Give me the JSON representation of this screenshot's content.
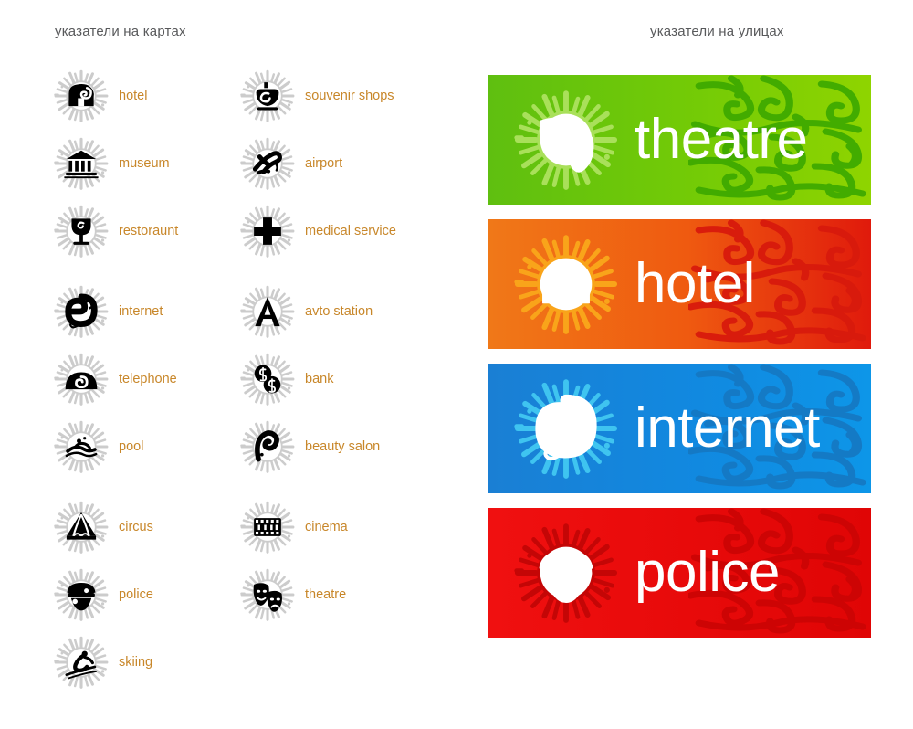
{
  "headers": {
    "left": "указатели на картах",
    "right": "указатели на улицах"
  },
  "colors": {
    "badge_gray": "#cccccc",
    "glyph_orange": "#f07818",
    "glyph_red": "#d8291c",
    "label_text": "#c8872a",
    "header_text": "#58595b",
    "theatre_left": "#5bbf10",
    "theatre_right": "#8fd400",
    "theatre_ornament": "#3faa00",
    "hotel_left": "#f07818",
    "hotel_right": "#e01a0c",
    "hotel_ornament": "#d81a0c",
    "internet_left": "#1a7fd4",
    "internet_right": "#0d96e8",
    "internet_ornament": "#1579c4",
    "police_left": "#ef0f0f",
    "police_right": "#e00505",
    "police_ornament": "#cc0404"
  },
  "map_markers": {
    "column_1": [
      {
        "label": "hotel",
        "icon": "hotel-icon"
      },
      {
        "label": "museum",
        "icon": "museum-icon"
      },
      {
        "label": "restoraunt",
        "icon": "restaurant-icon"
      },
      {
        "label": "internet",
        "icon": "internet-e-icon"
      },
      {
        "label": "telephone",
        "icon": "telephone-icon"
      },
      {
        "label": "pool",
        "icon": "pool-icon"
      },
      {
        "label": "circus",
        "icon": "circus-tent-icon"
      },
      {
        "label": "police",
        "icon": "police-cap-icon"
      },
      {
        "label": "skiing",
        "icon": "skier-icon"
      }
    ],
    "column_2": [
      {
        "label": "souvenir shops",
        "icon": "souvenir-vase-icon"
      },
      {
        "label": "airport",
        "icon": "airplane-icon"
      },
      {
        "label": "medical service",
        "icon": "medical-cross-icon"
      },
      {
        "label": "avto station",
        "icon": "letter-a-icon"
      },
      {
        "label": "bank",
        "icon": "dollar-coins-icon"
      },
      {
        "label": "beauty salon",
        "icon": "beauty-curl-icon"
      },
      {
        "label": "cinema",
        "icon": "film-strip-icon"
      },
      {
        "label": "theatre",
        "icon": "theatre-masks-icon"
      }
    ]
  },
  "street_signs": [
    {
      "label": "theatre",
      "icon": "theatre-masks-icon",
      "theme": "theatre"
    },
    {
      "label": "hotel",
      "icon": "hotel-icon",
      "theme": "hotel"
    },
    {
      "label": "internet",
      "icon": "internet-e-icon",
      "theme": "internet"
    },
    {
      "label": "police",
      "icon": "police-cap-icon",
      "theme": "police"
    }
  ]
}
